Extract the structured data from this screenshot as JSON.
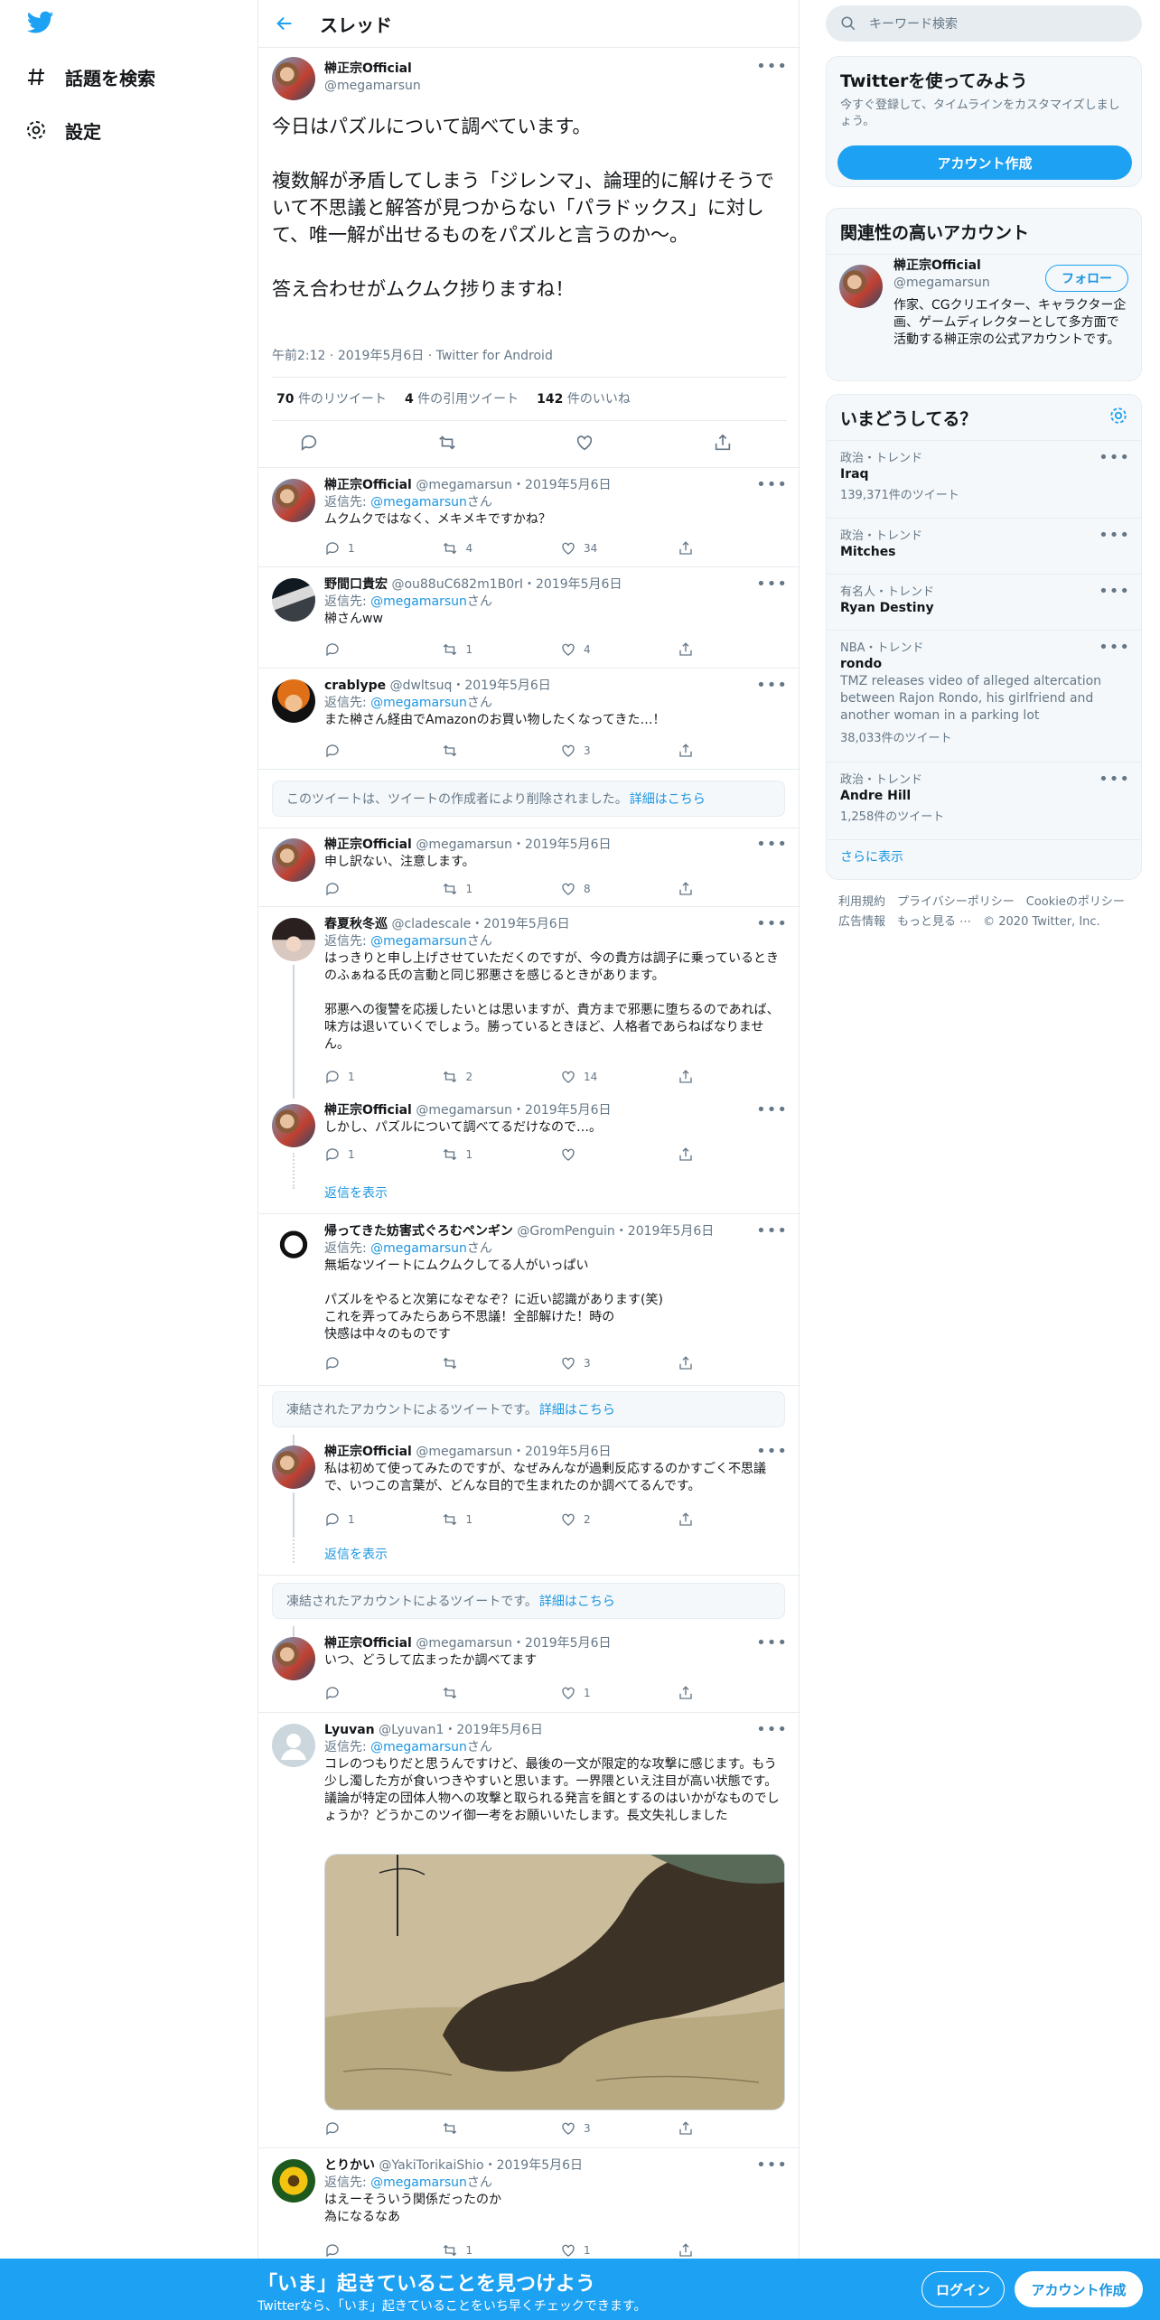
{
  "nav": {
    "explore_label": "話題を検索",
    "settings_label": "設定"
  },
  "header": {
    "title": "スレッド"
  },
  "main_tweet": {
    "name": "榊正宗Official",
    "handle": "@megamarsun",
    "text": "今日はパズルについて調べています。\n\n複数解が矛盾してしまう「ジレンマ」、論理的に解けそうでいて不思議と解答が見つからない「パラドックス」に対して、唯一解が出せるものをパズルと言うのか〜。\n\n答え合わせがムクムク捗りますね！",
    "time": "午前2:12",
    "date": "2019年5月6日",
    "source": "Twitter for Android",
    "retweets": "70",
    "retweets_label": "件のリツイート",
    "quotes": "4",
    "quotes_label": "件の引用ツイート",
    "likes": "142",
    "likes_label": "件のいいね"
  },
  "replying_prefix": "返信先: ",
  "replying_suffix": "さん",
  "replying_to": "@megamarsun",
  "tweets": [
    {
      "name": "榊正宗Official",
      "meta": "@megamarsun・2019年5月6日",
      "text": "ムクムクではなく、メキメキですかね？",
      "replies": "1",
      "retweets": "4",
      "likes": "34"
    },
    {
      "name": "野間口貴宏",
      "meta": "@ou88uC682m1B0rI・2019年5月6日",
      "text": "榊さんww",
      "replies": "",
      "retweets": "1",
      "likes": "4"
    },
    {
      "name": "crablype",
      "meta": "@dwltsuq・2019年5月6日",
      "text": "また榊さん経由でAmazonのお買い物したくなってきた…！",
      "replies": "",
      "retweets": "",
      "likes": "3"
    },
    {
      "name": "榊正宗Official",
      "meta": "@megamarsun・2019年5月6日",
      "text": "申し訳ない、注意します。",
      "replies": "",
      "retweets": "1",
      "likes": "8"
    },
    {
      "name": "春夏秋冬巡",
      "meta": "@cladescale・2019年5月6日",
      "text": "はっきりと申し上げさせていただくのですが、今の貴方は調子に乗っているときのふぁねる氏の言動と同じ邪悪さを感じるときがあります。\n\n邪悪への復讐を応援したいとは思いますが、貴方まで邪悪に堕ちるのであれば、味方は退いていくでしょう。勝っているときほど、人格者であらねばなりません。",
      "replies": "1",
      "retweets": "2",
      "likes": "14"
    },
    {
      "name": "榊正宗Official",
      "meta": "@megamarsun・2019年5月6日",
      "text": "しかし、パズルについて調べてるだけなので…。",
      "replies": "1",
      "retweets": "1",
      "likes": ""
    },
    {
      "name": "帰ってきた妨害式ぐろむペンギン",
      "meta": "@GromPenguin・2019年5月6日",
      "text": "無垢なツイートにムクムクしてる人がいっぱい\n\nパズルをやると次第になぞなぞ？に近い認識があります(笑)\nこれを弄ってみたらあら不思議！全部解けた！時の\n快感は中々のものです",
      "replies": "",
      "retweets": "",
      "likes": "3"
    },
    {
      "name": "榊正宗Official",
      "meta": "@megamarsun・2019年5月6日",
      "text": "私は初めて使ってみたのですが、なぜみんなが過剰反応するのかすごく不思議で、いつこの言葉が、どんな目的で生まれたのか調べてるんです。",
      "replies": "1",
      "retweets": "1",
      "likes": "2"
    },
    {
      "name": "榊正宗Official",
      "meta": "@megamarsun・2019年5月6日",
      "text": "いつ、どうして広まったか調べてます",
      "replies": "",
      "retweets": "",
      "likes": "1"
    },
    {
      "name": "Lyuvan",
      "meta": "@Lyuvan1・2019年5月6日",
      "text": "コレのつもりだと思うんですけど、最後の一文が限定的な攻撃に感じます。もう少し濁した方が食いつきやすいと思います。一界隈といえ注目が高い状態です。議論が特定の団体人物への攻撃と取られる発言を餌とするのはいかがなものでしょうか？どうかこのツイ御一考をお願いいたします。長文失礼しました",
      "replies": "",
      "retweets": "",
      "likes": "3"
    },
    {
      "name": "とりかい",
      "meta": "@YakiTorikaiShio・2019年5月6日",
      "text": "はえーそういう関係だったのか\n為になるなあ",
      "replies": "",
      "retweets": "1",
      "likes": "1"
    }
  ],
  "notices": {
    "deleted": "このツイートは、ツイートの作成者により削除されました。",
    "suspended": "凍結されたアカウントによるツイートです。",
    "learn_more": "詳細はこちら"
  },
  "show_replies": "返信を表示",
  "right": {
    "search_placeholder": "キーワード検索",
    "signup_title": "Twitterを使ってみよう",
    "signup_desc": "今すぐ登録して、タイムラインをカスタマイズしましょう。",
    "signup_button": "アカウント作成",
    "relevant_title": "関連性の高いアカウント",
    "relevant_name": "榊正宗Official",
    "relevant_handle": "@megamarsun",
    "follow_button": "フォロー",
    "relevant_bio": "作家、CGクリエイター、キャラクター企画、ゲームディレクターとして多方面で活動する榊正宗の公式アカウントです。",
    "trends_title": "いまどうしてる？",
    "trends": [
      {
        "context": "政治・トレンド",
        "name": "Iraq",
        "count": "139,371件のツイート"
      },
      {
        "context": "政治・トレンド",
        "name": "Mitches",
        "count": ""
      },
      {
        "context": "有名人・トレンド",
        "name": "Ryan Destiny",
        "count": ""
      },
      {
        "context": "NBA・トレンド",
        "name": "rondo",
        "count": "38,033件のツイート",
        "desc": "TMZ releases video of alleged altercation between Rajon Rondo, his girlfriend and another woman in a parking lot"
      },
      {
        "context": "政治・トレンド",
        "name": "Andre Hill",
        "count": "1,258件のツイート"
      }
    ],
    "show_more": "さらに表示",
    "footer_line1": "利用規約　プライバシーポリシー　Cookieのポリシー",
    "footer_line2": "広告情報　もっと見る ⋯　© 2020 Twitter, Inc."
  },
  "bottom": {
    "headline": "「いま」起きていることを見つけよう",
    "sub": "Twitterなら、「いま」起きていることをいち早くチェックできます。",
    "login": "ログイン",
    "signup": "アカウント作成"
  }
}
